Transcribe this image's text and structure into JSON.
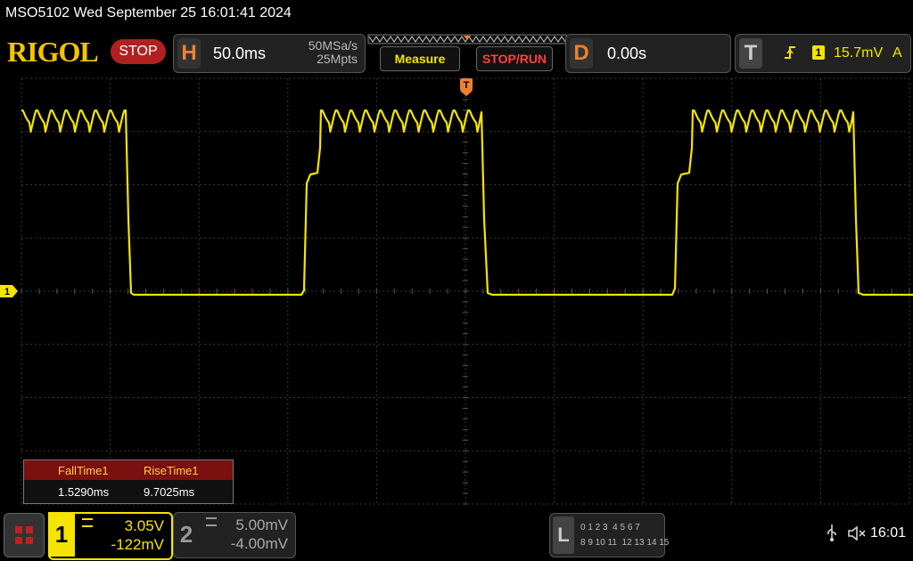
{
  "titlebar": {
    "text": "MSO5102  Wed September 25 16:01:41 2024"
  },
  "toolbar": {
    "logo": "RIGOL",
    "run_state": "STOP",
    "horizontal": {
      "letter": "H",
      "timebase": "50.0ms",
      "sample_rate": "50MSa/s",
      "memory_depth": "25Mpts"
    },
    "measure_label": "Measure",
    "stop_run_label": "STOP/RUN",
    "delay": {
      "letter": "D",
      "value": "0.00s"
    },
    "trigger": {
      "letter": "T",
      "channel": "1",
      "level": "15.7mV",
      "mode": "A"
    }
  },
  "screen": {
    "trigger_marker": "T",
    "channel_marker": "1",
    "colors": {
      "trace": "#f5e400",
      "grid": "#3a3a3a",
      "trigger": "#f08030",
      "background": "#000000"
    }
  },
  "measurements": [
    {
      "name": "FallTime1",
      "value": "1.5290ms"
    },
    {
      "name": "RiseTime1",
      "value": "9.7025ms"
    }
  ],
  "bottom": {
    "ch1": {
      "number": "1",
      "scale": "3.05V",
      "offset": "-122mV",
      "coupling_icon": "dc-coupling-icon"
    },
    "ch2": {
      "number": "2",
      "scale": "5.00mV",
      "offset": "-4.00mV",
      "coupling_icon": "dc-coupling-icon"
    },
    "logic": {
      "letter": "L",
      "row1": "0 1 2 3  4 5 6 7",
      "row2": "8 9 10 11  12 13 14 15"
    },
    "time": "16:01"
  }
}
